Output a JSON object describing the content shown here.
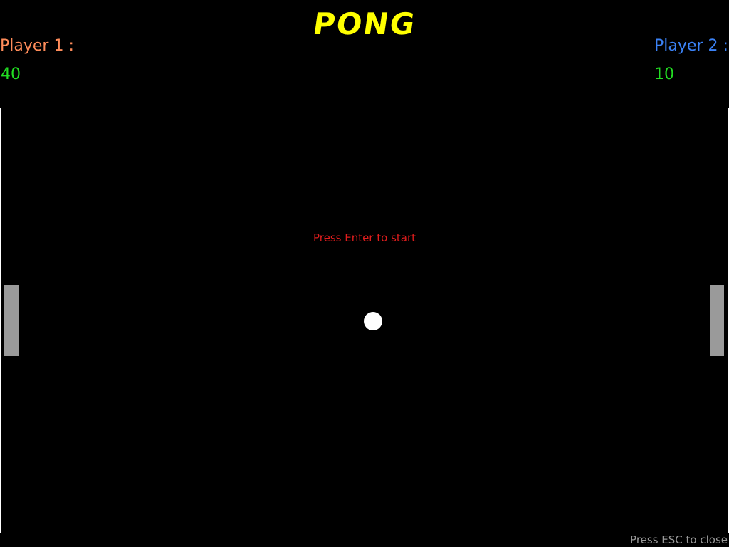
{
  "header": {
    "title": "PONG"
  },
  "players": {
    "p1": {
      "label": "Player 1 :",
      "score": "40"
    },
    "p2": {
      "label": "Player 2 :",
      "score": "10"
    }
  },
  "court": {
    "start_message": "Press Enter to start",
    "icons": {
      "left_paddle": "paddle-icon",
      "right_paddle": "paddle-icon",
      "ball": "ball-icon"
    }
  },
  "footer": {
    "close_hint": "Press ESC to close"
  },
  "colors": {
    "title": "#ffff00",
    "player1_label": "#ff8c5a",
    "player2_label": "#3b82f6",
    "score": "#22dd22",
    "start_message": "#e11d1d",
    "close_hint": "#9a9a9a",
    "paddle": "#9a9a9a",
    "ball": "#ffffff",
    "court_border": "#ffffff",
    "background": "#000000"
  }
}
